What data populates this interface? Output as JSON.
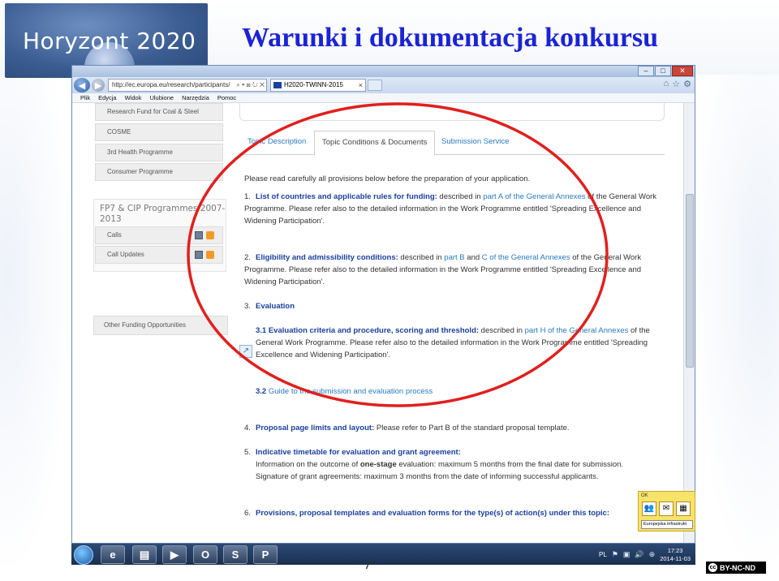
{
  "slide": {
    "logo_text": "Horyzont 2020",
    "title": "Warunki i dokumentacja konkursu",
    "page_number": "7",
    "license_badge": "BY-NC-ND",
    "license_circle": "cc",
    "accent_title_color": "#1b24d4",
    "annotation_color": "#e0201e"
  },
  "browser": {
    "address": "http://ec.europa.eu/research/participants/",
    "address_icons": "⌕ ▾ ⊠ ↻ ✕",
    "tab_title": "H2020-TWINN-2015",
    "tab_close": "×",
    "window_buttons": [
      "–",
      "□",
      "✕"
    ],
    "menu": [
      "Plik",
      "Edycja",
      "Widok",
      "Ulubione",
      "Narzędzia",
      "Pomoc"
    ],
    "nav_icons": [
      "⌂",
      "☆",
      "⚙"
    ],
    "back_glyph": "◀",
    "forward_glyph": "▶"
  },
  "sidebar": {
    "items_top": [
      "Research Fund for Coal & Steel",
      "COSME",
      "3rd Health Programme",
      "Consumer Programme"
    ],
    "group_title": "FP7 & CIP Programmes 2007-2013",
    "sub_items": [
      "Calls",
      "Call Updates"
    ],
    "other": "Other Funding Opportunities"
  },
  "main": {
    "tabs": [
      "Topic Description",
      "Topic Conditions & Documents",
      "Submission Service"
    ],
    "intro": "Please read carefully all provisions below before the preparation of your application.",
    "item1": {
      "num": "1.",
      "bold": "List of countries and applicable rules for funding:",
      "t1": " described in ",
      "link": "part A of the General Annexes",
      "t2": " of the General Work Programme. Please refer also to the detailed information in the Work Programme entitled 'Spreading Excellence and Widening Participation'."
    },
    "item2": {
      "num": "2.",
      "bold": "Eligibility and admissibility conditions:",
      "t1": " described in ",
      "link1": "part B",
      "t2": " and ",
      "link2": "C of the General Annexes",
      "t3": " of the General Work Programme. Please refer also to the detailed information in the Work Programme entitled 'Spreading Excellence and Widening Participation'."
    },
    "item3": {
      "num": "3.",
      "bold": "Evaluation"
    },
    "item31": {
      "bold": "3.1  Evaluation criteria and procedure, scoring and threshold:",
      "t1": " described in ",
      "link": "part H of the General Annexes",
      "t2": " of the General Work Programme. Please refer also to the detailed information in the Work Programme entitled 'Spreading Excellence and Widening Participation'."
    },
    "item32": {
      "bold": "3.2",
      "link": " Guide to the submission and evaluation process"
    },
    "item4": {
      "num": "4.",
      "bold": "Proposal page limits and layout:",
      "t1": " Please refer to Part B of the standard proposal template."
    },
    "item5": {
      "num": "5.",
      "bold": "Indicative timetable for evaluation and grant agreement:",
      "l1a": "Information on the outcome of ",
      "l1b": "one-stage",
      "l1c": " evaluation: maximum 5 months from the final date for submission.",
      "l2": "Signature of grant agreements: maximum 3 months from the date of informing successful applicants."
    },
    "item6": {
      "num": "6.",
      "bold": "Provisions, proposal templates and evaluation forms for the type(s) of action(s) under this topic:"
    },
    "ext_icon": "↗"
  },
  "langbar": {
    "label": "OK",
    "select": "Europejska infrastrukt",
    "icons": [
      "👥",
      "✉",
      "▦"
    ]
  },
  "taskbar": {
    "apps": [
      "e",
      "▤",
      "▶",
      "O",
      "S",
      "P"
    ],
    "lang": "PL",
    "tray_icons": [
      "⚑",
      "▣",
      "🔊",
      "⊕"
    ],
    "time": "17:23",
    "date": "2014-11-03"
  }
}
